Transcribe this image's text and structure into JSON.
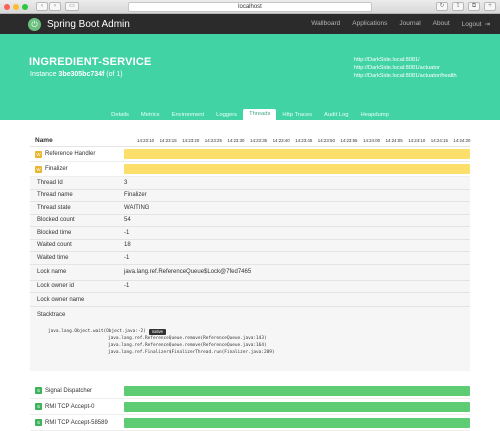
{
  "browser": {
    "url": "localhost",
    "colors": {
      "close": "#fc5f57",
      "min": "#fdbc2e",
      "max": "#28c840"
    }
  },
  "nav": {
    "brand": "Spring Boot Admin",
    "links": [
      "Wallboard",
      "Applications",
      "Journal",
      "About"
    ],
    "logout": "Logout"
  },
  "header": {
    "title": "INGREDIENT-SERVICE",
    "instance_prefix": "Instance",
    "instance_id": "3be305bc734f",
    "instance_suffix": "(of 1)",
    "urls": [
      "http://DarkSide.local:8081/",
      "http://DarkSide.local:8081/actuator",
      "http://DarkSide.local:8081/actuator/health"
    ]
  },
  "tabs": [
    "Details",
    "Metrics",
    "Environment",
    "Loggers",
    "Threads",
    "Http Traces",
    "Audit Log",
    "Heapdump"
  ],
  "active_tab": "Threads",
  "threads": {
    "name_header": "Name",
    "ticks": [
      "14:23:10",
      "14:23:15",
      "14:23:20",
      "14:23:25",
      "14:23:30",
      "14:23:35",
      "14:23:40",
      "14:23:45",
      "14:23:50",
      "14:23:55",
      "14:24:00",
      "14:24:05",
      "14:24:10",
      "14:24:15",
      "14:24:20"
    ],
    "state_colors": {
      "WAITING": "#fcde6b",
      "RUNNABLE": "#5dcc72"
    },
    "rows_top": [
      {
        "badge": "W",
        "name": "Reference Handler",
        "state": "WAITING"
      },
      {
        "badge": "W",
        "name": "Finalizer",
        "state": "WAITING"
      }
    ],
    "details": [
      {
        "key": "Thread Id",
        "value": "3"
      },
      {
        "key": "Thread name",
        "value": "Finalizer"
      },
      {
        "key": "Thread state",
        "value": "WAITING"
      },
      {
        "key": "Blocked count",
        "value": "54"
      },
      {
        "key": "Blocked time",
        "value": "-1"
      },
      {
        "key": "Waited count",
        "value": "18"
      },
      {
        "key": "Waited time",
        "value": "-1"
      },
      {
        "key": "Lock name",
        "value": "java.lang.ref.ReferenceQueue$Lock@7fed7465"
      },
      {
        "key": "Lock owner id",
        "value": "-1"
      },
      {
        "key": "Lock owner name",
        "value": ""
      },
      {
        "key": "Stacktrace",
        "value": ""
      }
    ],
    "stacktrace": [
      "java.lang.Object.wait(Object.java:-2)",
      "java.lang.ref.ReferenceQueue.remove(ReferenceQueue.java:143)",
      "java.lang.ref.ReferenceQueue.remove(ReferenceQueue.java:164)",
      "java.lang.ref.Finalizer$FinalizerThread.run(Finalizer.java:209)"
    ],
    "native_label": "native",
    "rows_bottom": [
      {
        "badge": "S",
        "name": "Signal Dispatcher",
        "state": "RUNNABLE"
      },
      {
        "badge": "S",
        "name": "RMI TCP Accept-0",
        "state": "RUNNABLE"
      },
      {
        "badge": "S",
        "name": "RMI TCP Accept-58589",
        "state": "RUNNABLE"
      }
    ]
  }
}
